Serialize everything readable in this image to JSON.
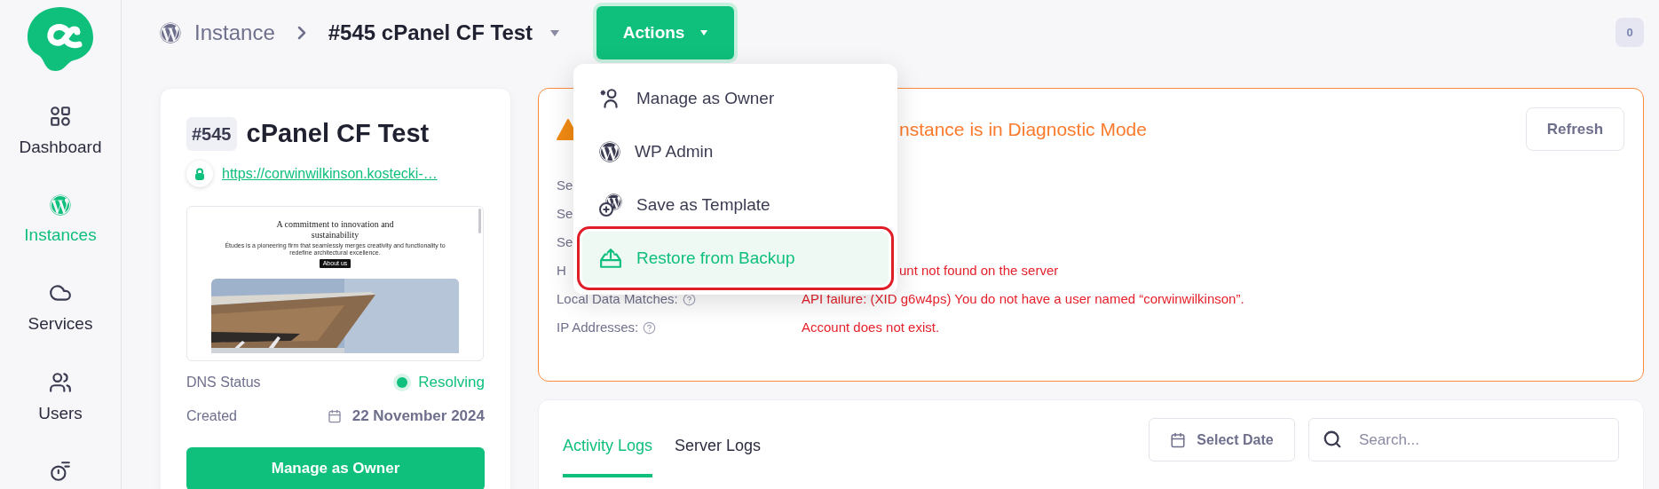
{
  "sidebar": {
    "items": [
      {
        "label": "Dashboard",
        "selected": false
      },
      {
        "label": "Instances",
        "selected": true
      },
      {
        "label": "Services",
        "selected": false
      },
      {
        "label": "Users",
        "selected": false
      },
      {
        "selected": false
      }
    ]
  },
  "breadcrumb": {
    "section": "Instance",
    "current": "#545 cPanel CF Test"
  },
  "actions_button": {
    "label": "Actions",
    "expanded": true
  },
  "notification_count": "0",
  "actions_menu": {
    "items": [
      {
        "label": "Manage as Owner",
        "selected": false
      },
      {
        "label": "WP Admin",
        "selected": false
      },
      {
        "label": "Save as Template",
        "selected": false
      },
      {
        "label": "Restore from Backup",
        "selected": true
      }
    ]
  },
  "instance_card": {
    "id": "#545",
    "name": "cPanel CF Test",
    "url": "https://corwinwilkinson.kostecki-…",
    "preview": {
      "heading": "A commitment to innovation and sustainability",
      "body": "Études is a pioneering firm that seamlessly merges creativity and functionality to redefine architectural excellence.",
      "button": "About us"
    },
    "dns": {
      "label": "DNS Status",
      "value": "Resolving",
      "color": "#10c17d"
    },
    "created": {
      "label": "Created",
      "value": "22 November 2024"
    },
    "button": "Manage as Owner"
  },
  "diagnostic_alert": {
    "title": "nstance is in Diagnostic Mode",
    "title_obscured": true,
    "refresh": "Refresh",
    "rows": [
      {
        "label": "Se"
      },
      {
        "label": "Se"
      },
      {
        "label": "Se"
      },
      {
        "label": "H",
        "value": "unt not found on the server",
        "value_obscured": true
      },
      {
        "label": "Local Data Matches:",
        "help": true,
        "value": "API failure: (XID g6w4ps) You do not have a user named “corwinwilkinson”."
      },
      {
        "label": "IP Addresses:",
        "help": true,
        "value": "Account does not exist."
      }
    ]
  },
  "logs": {
    "tabs": [
      {
        "label": "Activity Logs",
        "selected": true
      },
      {
        "label": "Server Logs",
        "selected": false
      }
    ],
    "date_button": "Select Date",
    "search": {
      "placeholder": "Search..."
    }
  }
}
